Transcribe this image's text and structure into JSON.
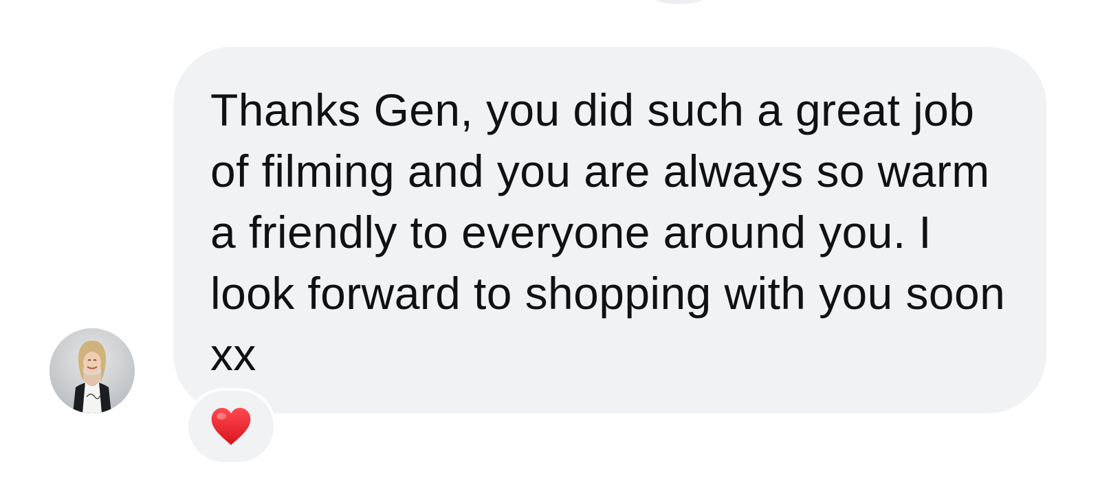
{
  "message": {
    "text": "Thanks Gen, you did such a great job of filming and you are always so warm a friendly to everyone around you. I look forward to shopping with you soon xx"
  },
  "reaction": {
    "icon": "heart-icon",
    "color": "#e0242b"
  },
  "colors": {
    "bubble": "#f1f2f4",
    "text": "#111111",
    "background": "#ffffff"
  }
}
